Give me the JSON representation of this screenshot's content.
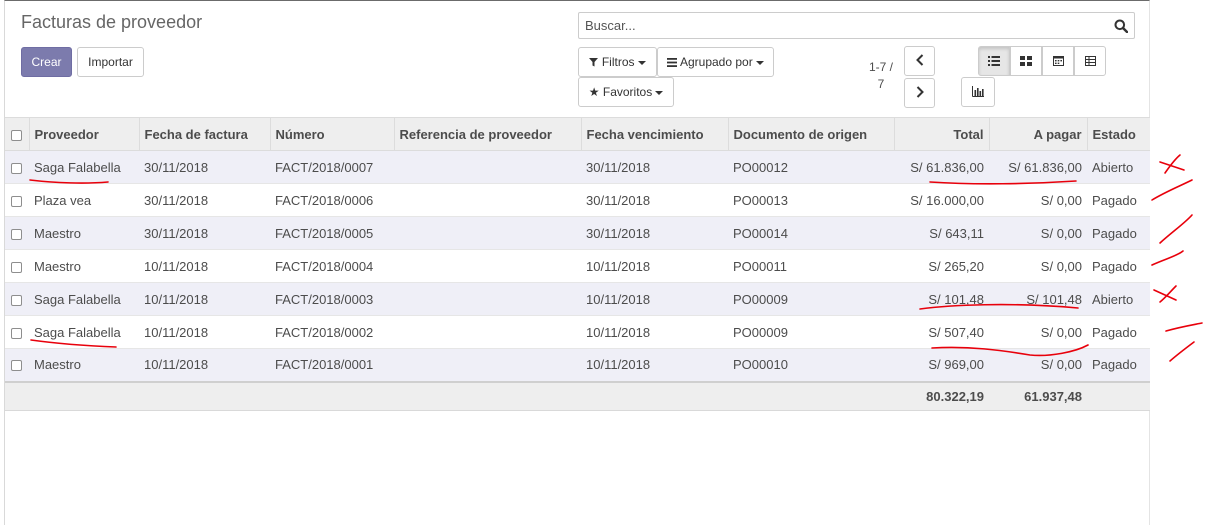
{
  "page": {
    "title": "Facturas de proveedor",
    "create_label": "Crear",
    "import_label": "Importar"
  },
  "search": {
    "placeholder": "Buscar...",
    "icon": "search-icon"
  },
  "filters": {
    "filters_label": "Filtros",
    "group_label": "Agrupado por",
    "favorites_label": "Favoritos"
  },
  "pager": {
    "value": "1-7 /\n7",
    "prev_icon": "chevron-left-icon",
    "next_icon": "chevron-right-icon"
  },
  "views": [
    {
      "name": "list",
      "icon": "list-icon",
      "active": true
    },
    {
      "name": "kanban",
      "icon": "kanban-icon",
      "active": false
    },
    {
      "name": "calendar",
      "icon": "calendar-icon",
      "active": false
    },
    {
      "name": "pivot",
      "icon": "pivot-icon",
      "active": false
    },
    {
      "name": "graph",
      "icon": "bar-chart-icon",
      "active": false
    }
  ],
  "table": {
    "headers": {
      "proveedor": "Proveedor",
      "fecha": "Fecha de factura",
      "numero": "Número",
      "referencia": "Referencia de proveedor",
      "vencimiento": "Fecha vencimiento",
      "origen": "Documento de origen",
      "total": "Total",
      "apagar": "A pagar",
      "estado": "Estado"
    },
    "rows": [
      {
        "proveedor": "Saga Falabella",
        "fecha": "30/11/2018",
        "numero": "FACT/2018/0007",
        "referencia": "",
        "vencimiento": "30/11/2018",
        "origen": "PO00012",
        "total": "S/ 61.836,00",
        "apagar": "S/ 61.836,00",
        "estado": "Abierto"
      },
      {
        "proveedor": "Plaza vea",
        "fecha": "30/11/2018",
        "numero": "FACT/2018/0006",
        "referencia": "",
        "vencimiento": "30/11/2018",
        "origen": "PO00013",
        "total": "S/ 16.000,00",
        "apagar": "S/ 0,00",
        "estado": "Pagado"
      },
      {
        "proveedor": "Maestro",
        "fecha": "30/11/2018",
        "numero": "FACT/2018/0005",
        "referencia": "",
        "vencimiento": "30/11/2018",
        "origen": "PO00014",
        "total": "S/ 643,11",
        "apagar": "S/ 0,00",
        "estado": "Pagado"
      },
      {
        "proveedor": "Maestro",
        "fecha": "10/11/2018",
        "numero": "FACT/2018/0004",
        "referencia": "",
        "vencimiento": "10/11/2018",
        "origen": "PO00011",
        "total": "S/ 265,20",
        "apagar": "S/ 0,00",
        "estado": "Pagado"
      },
      {
        "proveedor": "Saga Falabella",
        "fecha": "10/11/2018",
        "numero": "FACT/2018/0003",
        "referencia": "",
        "vencimiento": "10/11/2018",
        "origen": "PO00009",
        "total": "S/ 101,48",
        "apagar": "S/ 101,48",
        "estado": "Abierto"
      },
      {
        "proveedor": "Saga Falabella",
        "fecha": "10/11/2018",
        "numero": "FACT/2018/0002",
        "referencia": "",
        "vencimiento": "10/11/2018",
        "origen": "PO00009",
        "total": "S/ 507,40",
        "apagar": "S/ 0,00",
        "estado": "Pagado"
      },
      {
        "proveedor": "Maestro",
        "fecha": "10/11/2018",
        "numero": "FACT/2018/0001",
        "referencia": "",
        "vencimiento": "10/11/2018",
        "origen": "PO00010",
        "total": "S/ 969,00",
        "apagar": "S/ 0,00",
        "estado": "Pagado"
      }
    ],
    "totals": {
      "total": "80.322,19",
      "apagar": "61.937,48"
    }
  },
  "colors": {
    "primary": "#7c7bad",
    "annotation": "#e8000b",
    "row_stripe": "#efeff7",
    "header_bg": "#eeeeee"
  }
}
